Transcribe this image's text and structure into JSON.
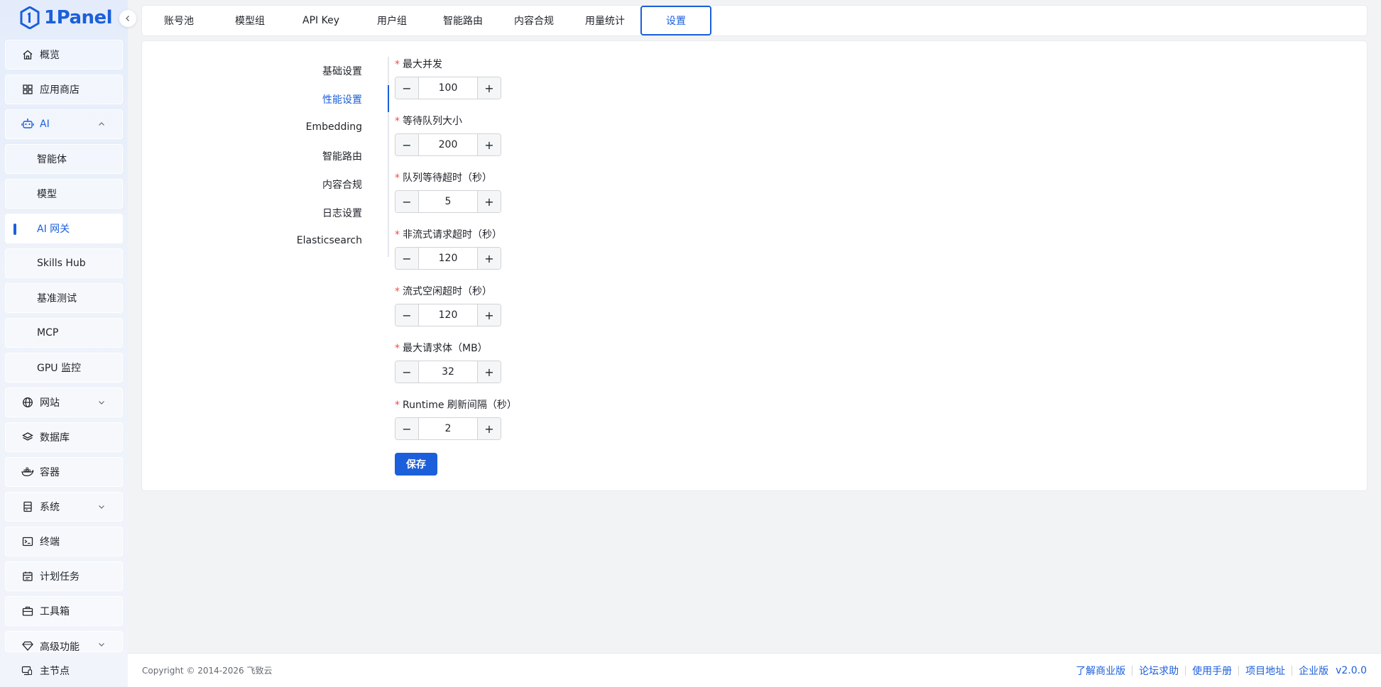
{
  "brand": {
    "name": "1Panel",
    "color": "#1b5fdb"
  },
  "sidebar": {
    "items": [
      {
        "label": "概览",
        "icon": "home-icon"
      },
      {
        "label": "应用商店",
        "icon": "grid-icon"
      },
      {
        "label": "AI",
        "icon": "robot-icon",
        "expanded": true
      },
      {
        "label": "智能体"
      },
      {
        "label": "模型"
      },
      {
        "label": "AI 网关",
        "active": true
      },
      {
        "label": "Skills Hub"
      },
      {
        "label": "基准测试"
      },
      {
        "label": "MCP"
      },
      {
        "label": "GPU 监控"
      },
      {
        "label": "网站",
        "icon": "globe-icon"
      },
      {
        "label": "数据库",
        "icon": "layers-icon"
      },
      {
        "label": "容器",
        "icon": "docker-icon"
      },
      {
        "label": "系统",
        "icon": "server-icon"
      },
      {
        "label": "终端",
        "icon": "terminal-icon"
      },
      {
        "label": "计划任务",
        "icon": "calendar-icon"
      },
      {
        "label": "工具箱",
        "icon": "toolbox-icon"
      },
      {
        "label": "高级功能",
        "icon": "diamond-icon"
      }
    ],
    "bottom_node": "主节点"
  },
  "tabs": [
    "账号池",
    "模型组",
    "API Key",
    "用户组",
    "智能路由",
    "内容合规",
    "用量统计",
    "设置"
  ],
  "active_tab": "设置",
  "anchors": [
    "基础设置",
    "性能设置",
    "Embedding",
    "智能路由",
    "内容合规",
    "日志设置",
    "Elasticsearch"
  ],
  "active_anchor": "性能设置",
  "fields": [
    {
      "label": "最大并发",
      "value": "100"
    },
    {
      "label": "等待队列大小",
      "value": "200"
    },
    {
      "label": "队列等待超时（秒）",
      "value": "5"
    },
    {
      "label": "非流式请求超时（秒）",
      "value": "120"
    },
    {
      "label": "流式空闲超时（秒）",
      "value": "120"
    },
    {
      "label": "最大请求体（MB）",
      "value": "32"
    },
    {
      "label": "Runtime 刷新间隔（秒）",
      "value": "2"
    }
  ],
  "required_mark": "*",
  "stepper": {
    "minus": "−",
    "plus": "+"
  },
  "save_label": "保存",
  "footer": {
    "copyright": "Copyright © 2014-2026 飞致云",
    "links": [
      "了解商业版",
      "论坛求助",
      "使用手册",
      "项目地址",
      "企业版"
    ],
    "version": "v2.0.0"
  }
}
